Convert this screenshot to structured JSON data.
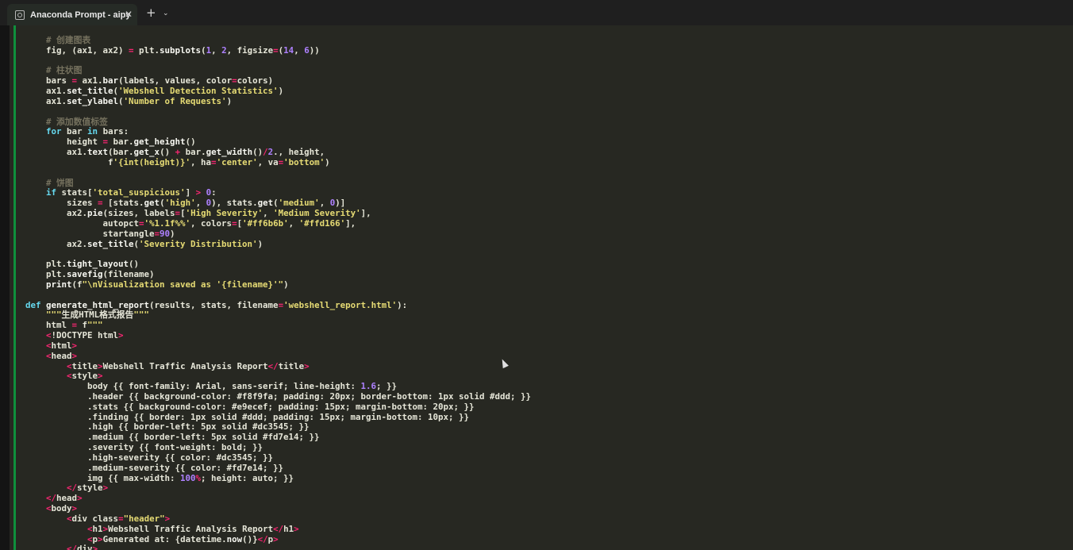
{
  "tab": {
    "title": "Anaconda Prompt - aipy",
    "icon": "terminal-icon",
    "close_glyph": "✕",
    "new_tab_glyph": "+",
    "menu_glyph": "⌄"
  },
  "code_lines": [
    "    # 创建图表",
    "    fig, (ax1, ax2) = plt.subplots(1, 2, figsize=(14, 6))",
    "",
    "    # 柱状图",
    "    bars = ax1.bar(labels, values, color=colors)",
    "    ax1.set_title('Webshell Detection Statistics')",
    "    ax1.set_ylabel('Number of Requests')",
    "",
    "    # 添加数值标签",
    "    for bar in bars:",
    "        height = bar.get_height()",
    "        ax1.text(bar.get_x() + bar.get_width()/2., height,",
    "                f'{int(height)}', ha='center', va='bottom')",
    "",
    "    # 饼图",
    "    if stats['total_suspicious'] > 0:",
    "        sizes = [stats.get('high', 0), stats.get('medium', 0)]",
    "        ax2.pie(sizes, labels=['High Severity', 'Medium Severity'],",
    "               autopct='%1.1f%%', colors=['#ff6b6b', '#ffd166'],",
    "               startangle=90)",
    "        ax2.set_title('Severity Distribution')",
    "",
    "    plt.tight_layout()",
    "    plt.savefig(filename)",
    "    print(f\"\\nVisualization saved as '{filename}'\")",
    "",
    "def generate_html_report(results, stats, filename='webshell_report.html'):",
    "    \"\"\"生成HTML格式报告\"\"\"",
    "    html = f\"\"\"",
    "    <!DOCTYPE html>",
    "    <html>",
    "    <head>",
    "        <title>Webshell Traffic Analysis Report</title>",
    "        <style>",
    "            body {{ font-family: Arial, sans-serif; line-height: 1.6; }}",
    "            .header {{ background-color: #f8f9fa; padding: 20px; border-bottom: 1px solid #ddd; }}",
    "            .stats {{ background-color: #e9ecef; padding: 15px; margin-bottom: 20px; }}",
    "            .finding {{ border: 1px solid #ddd; padding: 15px; margin-bottom: 10px; }}",
    "            .high {{ border-left: 5px solid #dc3545; }}",
    "            .medium {{ border-left: 5px solid #fd7e14; }}",
    "            .severity {{ font-weight: bold; }}",
    "            .high-severity {{ color: #dc3545; }}",
    "            .medium-severity {{ color: #fd7e14; }}",
    "            img {{ max-width: 100%; height: auto; }}",
    "        </style>",
    "    </head>",
    "    <body>",
    "        <div class=\"header\">",
    "            <h1>Webshell Traffic Analysis Report</h1>",
    "            <p>Generated at: {datetime.now()}</p>",
    "        </div>"
  ]
}
